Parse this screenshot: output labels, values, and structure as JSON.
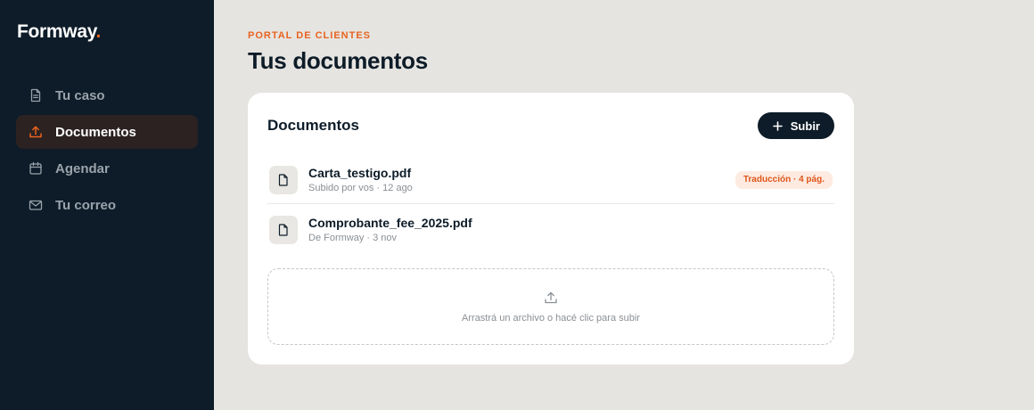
{
  "brand": {
    "name": "Formway",
    "dot": "."
  },
  "sidebar": {
    "items": [
      {
        "label": "Tu caso",
        "icon": "document-icon",
        "active": false
      },
      {
        "label": "Documentos",
        "icon": "upload-icon",
        "active": true
      },
      {
        "label": "Agendar",
        "icon": "calendar-icon",
        "active": false
      },
      {
        "label": "Tu correo",
        "icon": "mail-icon",
        "active": false
      }
    ]
  },
  "header": {
    "eyebrow": "PORTAL DE CLIENTES",
    "title": "Tus documentos"
  },
  "card": {
    "title": "Documentos",
    "upload_label": "Subir",
    "documents": [
      {
        "name": "Carta_testigo.pdf",
        "meta": "Subido por vos · 12 ago",
        "badge": "Traducción · 4 pág."
      },
      {
        "name": "Comprobante_fee_2025.pdf",
        "meta": "De Formway · 3 nov",
        "badge": ""
      }
    ],
    "dropzone_text": "Arrastrá un archivo o hacé clic para subir"
  },
  "colors": {
    "sidebar_bg": "#0d1c28",
    "accent": "#e8631f",
    "active_item_bg": "#2b2221",
    "page_bg": "#e6e4e0",
    "badge_bg": "#fdebe1"
  }
}
